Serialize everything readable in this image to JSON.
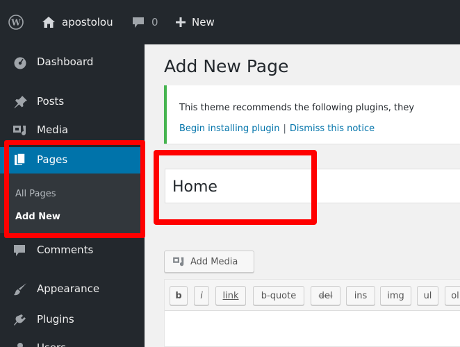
{
  "adminbar": {
    "wp_icon": "wordpress-logo-icon",
    "site_icon": "home-icon",
    "site_name": "apostolou",
    "comments_icon": "comment-bubble-icon",
    "comments_count": "0",
    "new_icon": "plus-icon",
    "new_label": "New"
  },
  "sidebar": {
    "items": [
      {
        "icon": "dashboard-icon",
        "label": "Dashboard"
      },
      {
        "icon": "pin-icon",
        "label": "Posts"
      },
      {
        "icon": "media-icon",
        "label": "Media"
      },
      {
        "icon": "pages-icon",
        "label": "Pages",
        "active": true
      },
      {
        "icon": "comment-icon",
        "label": "Comments"
      },
      {
        "icon": "brush-icon",
        "label": "Appearance"
      },
      {
        "icon": "plug-icon",
        "label": "Plugins"
      },
      {
        "icon": "users-icon",
        "label": "Users"
      }
    ],
    "submenu": {
      "all_pages": "All Pages",
      "add_new": "Add New"
    }
  },
  "main": {
    "page_title": "Add New Page",
    "notice": {
      "text": "This theme recommends the following plugins, they",
      "install_link": "Begin installing plugin",
      "separator": "|",
      "dismiss_link": "Dismiss this notice"
    },
    "title_field_value": "Home",
    "add_media_label": "Add Media",
    "toolbar": {
      "b": "b",
      "i": "i",
      "link": "link",
      "bquote": "b-quote",
      "del": "del",
      "ins": "ins",
      "img": "img",
      "ul": "ul",
      "ol": "ol"
    }
  },
  "colors": {
    "admin_bg": "#23282d",
    "active_blue": "#0073aa",
    "notice_green": "#46b450",
    "highlight_red": "#ff0000"
  }
}
